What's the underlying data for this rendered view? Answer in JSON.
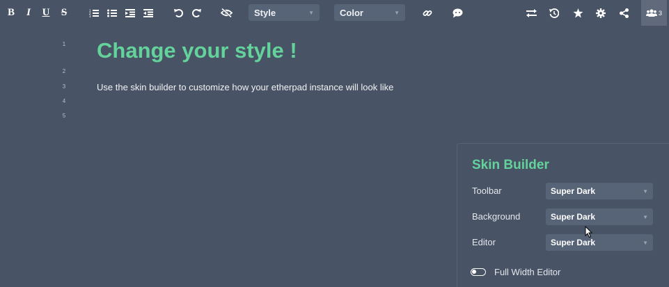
{
  "toolbar": {
    "bold_label": "B",
    "italic_label": "I",
    "underline_label": "U",
    "strike_label": "S",
    "style_select": "Style",
    "color_select": "Color",
    "users_count": "3",
    "icons": [
      "bold-icon",
      "italic-icon",
      "underline-icon",
      "strikethrough-icon",
      "ordered-list-icon",
      "unordered-list-icon",
      "indent-icon",
      "outdent-icon",
      "undo-icon",
      "redo-icon",
      "hide-authorship-icon",
      "link-icon",
      "comment-icon",
      "import-export-icon",
      "timeslider-icon",
      "star-icon",
      "gear-icon",
      "share-icon",
      "users-icon"
    ]
  },
  "editor": {
    "line_numbers": [
      "1",
      "2",
      "3",
      "4",
      "5"
    ],
    "heading": "Change your style !",
    "body": "Use the skin builder to customize how your etherpad instance will look like"
  },
  "skin_builder": {
    "title": "Skin Builder",
    "rows": [
      {
        "label": "Toolbar",
        "value": "Super Dark"
      },
      {
        "label": "Background",
        "value": "Super Dark"
      },
      {
        "label": "Editor",
        "value": "Super Dark"
      }
    ],
    "full_width_label": "Full Width Editor"
  },
  "colors": {
    "background": "#485365",
    "accent": "#64d29b",
    "select_bg": "#576377"
  }
}
